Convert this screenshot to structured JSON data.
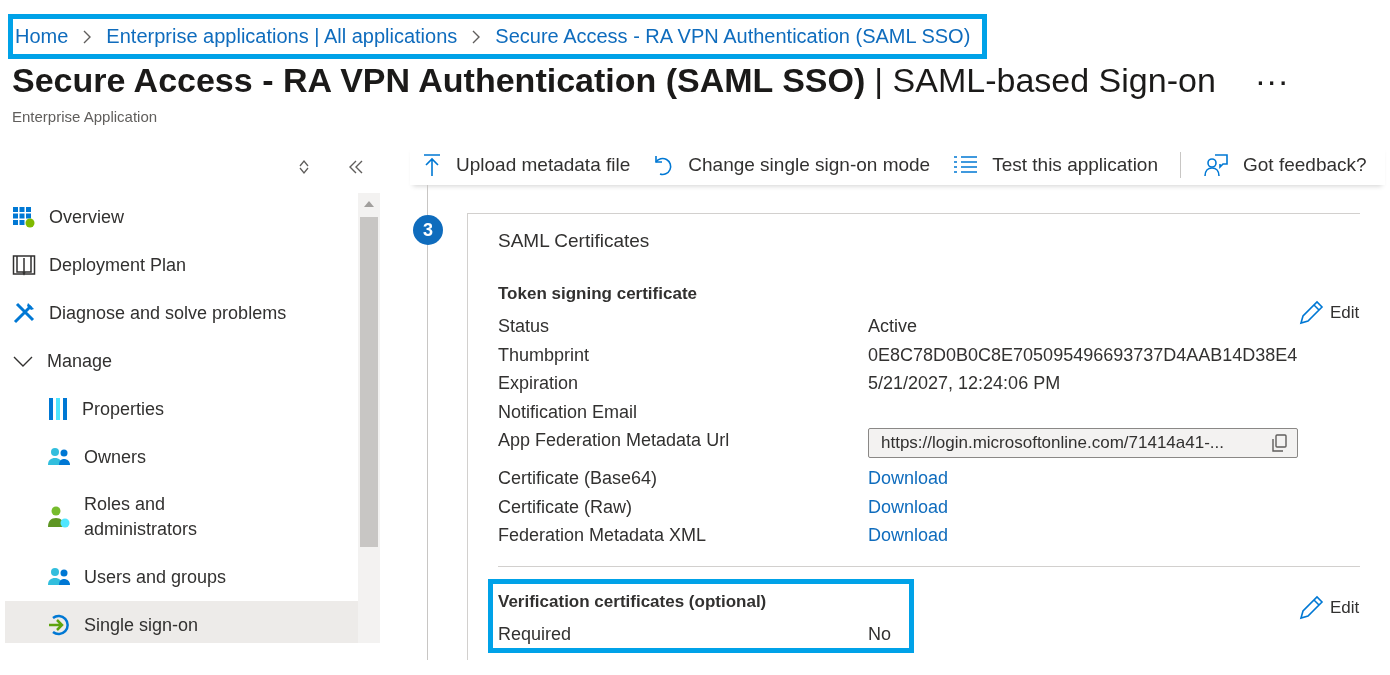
{
  "breadcrumb": {
    "highlighted": true,
    "items": [
      "Home",
      "Enterprise applications | All applications",
      "Secure Access - RA VPN Authentication (SAML SSO)"
    ]
  },
  "page": {
    "title": "Secure Access - RA VPN Authentication (SAML SSO)",
    "title_suffix": "| SAML-based Sign-on",
    "more": "···",
    "subtitle": "Enterprise Application"
  },
  "sidebar": {
    "items": [
      {
        "label": "Overview",
        "kind": "link",
        "selected": false
      },
      {
        "label": "Deployment Plan",
        "kind": "link",
        "selected": false
      },
      {
        "label": "Diagnose and solve problems",
        "kind": "link",
        "selected": false
      },
      {
        "label": "Manage",
        "kind": "group",
        "expanded": true,
        "children": [
          {
            "label": "Properties",
            "selected": false
          },
          {
            "label": "Owners",
            "selected": false
          },
          {
            "label": "Roles and administrators",
            "selected": false
          },
          {
            "label": "Users and groups",
            "selected": false
          },
          {
            "label": "Single sign-on",
            "selected": true
          }
        ]
      }
    ]
  },
  "toolbar": [
    {
      "label": "Upload metadata file"
    },
    {
      "label": "Change single sign-on mode"
    },
    {
      "label": "Test this application"
    },
    {
      "label": "Got feedback?"
    }
  ],
  "step": {
    "number": "3",
    "title": "SAML Certificates",
    "sections": [
      {
        "heading": "Token signing certificate",
        "edit": "Edit",
        "highlighted": false,
        "rows": [
          {
            "label": "Status",
            "kind": "text",
            "value": "Active"
          },
          {
            "label": "Thumbprint",
            "kind": "text",
            "value": "0E8C78D0B0C8E705095496693737D4AAB14D38E4"
          },
          {
            "label": "Expiration",
            "kind": "text",
            "value": "5/21/2027, 12:24:06 PM"
          },
          {
            "label": "Notification Email",
            "kind": "text"
          },
          {
            "label": "App Federation Metadata Url",
            "kind": "field",
            "value": "https://login.microsoftonline.com/71414a41-..."
          },
          {
            "label": "Certificate (Base64)",
            "kind": "link",
            "value": "Download"
          },
          {
            "label": "Certificate (Raw)",
            "kind": "link",
            "value": "Download"
          },
          {
            "label": "Federation Metadata XML",
            "kind": "link",
            "value": "Download"
          }
        ]
      },
      {
        "heading": "Verification certificates (optional)",
        "edit": "Edit",
        "highlighted": true,
        "rows": [
          {
            "label": "Required",
            "kind": "text",
            "value": "No"
          }
        ]
      }
    ]
  }
}
